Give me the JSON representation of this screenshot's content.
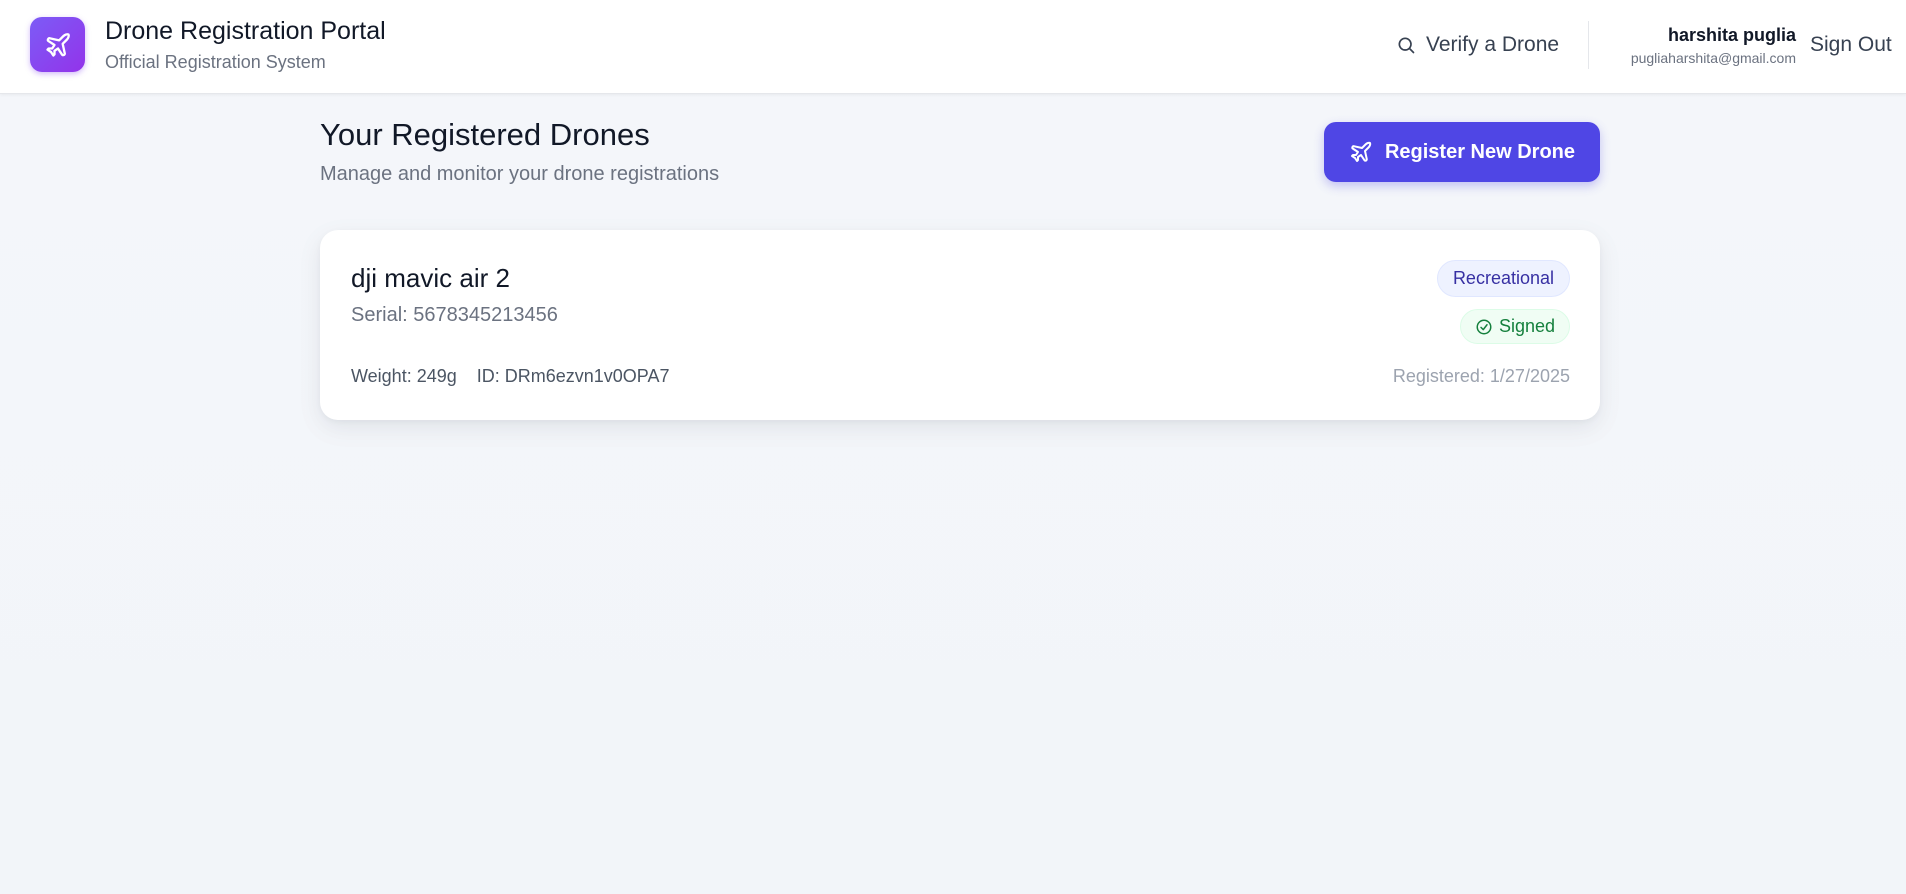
{
  "header": {
    "title": "Drone Registration Portal",
    "subtitle": "Official Registration System",
    "verify_label": "Verify a Drone",
    "user_name": "harshita puglia",
    "user_email": "pugliaharshita@gmail.com",
    "signout_label": "Sign Out",
    "logo_icon": "plane-icon",
    "verify_icon": "search-icon"
  },
  "main": {
    "title": "Your Registered Drones",
    "subtitle": "Manage and monitor your drone registrations",
    "register_label": "Register New Drone",
    "register_icon": "plane-icon"
  },
  "drones": [
    {
      "name": "dji mavic air 2",
      "serial": "Serial: 5678345213456",
      "weight": "Weight: 249g",
      "id": "ID: DRm6ezvn1v0OPA7",
      "category": "Recreational",
      "status": "Signed",
      "registered": "Registered: 1/27/2025"
    }
  ],
  "colors": {
    "accent": "#4f46e5",
    "logo_gradient_start": "#7c5cf6",
    "logo_gradient_end": "#9333ea",
    "signed_green": "#15803d",
    "category_indigo": "#3730a3"
  }
}
